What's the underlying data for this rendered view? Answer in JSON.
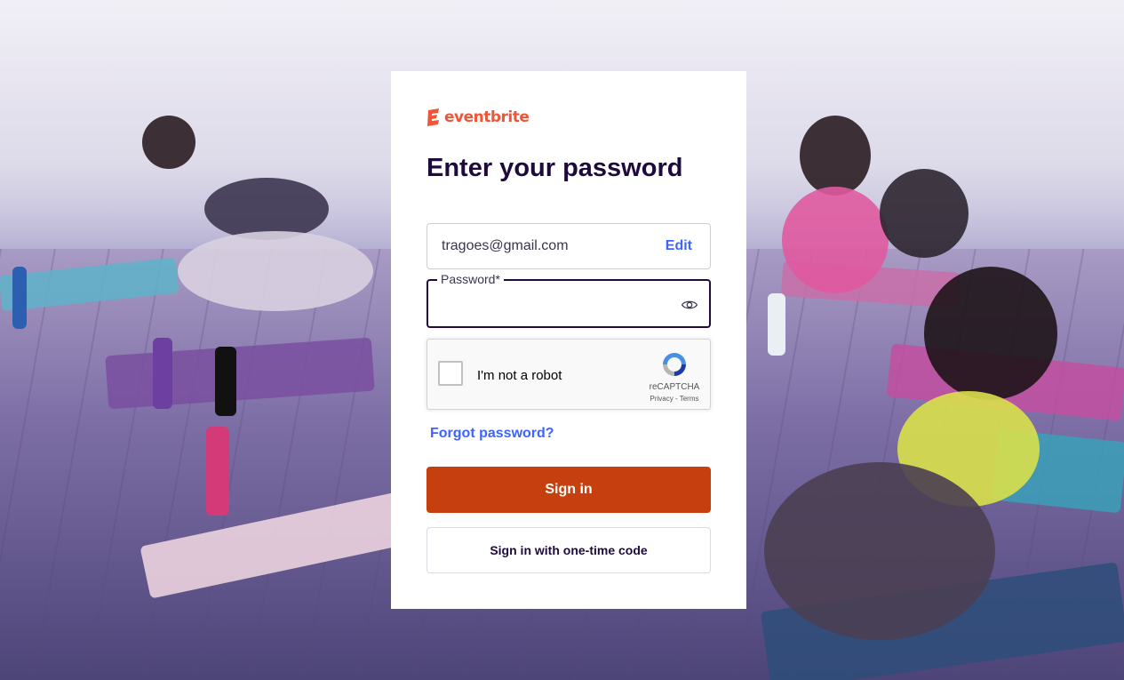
{
  "brand": {
    "name": "eventbrite",
    "color": "#f05537"
  },
  "page": {
    "title": "Enter your password"
  },
  "email": {
    "value": "tragoes@gmail.com",
    "edit_label": "Edit"
  },
  "password": {
    "label": "Password*",
    "value": "",
    "toggle_icon": "eye-icon"
  },
  "captcha": {
    "label": "I'm not a robot",
    "brand": "reCAPTCHA",
    "terms": "Privacy - Terms",
    "checked": false
  },
  "links": {
    "forgot_password": "Forgot password?"
  },
  "buttons": {
    "sign_in": "Sign in",
    "one_time_code": "Sign in with one-time code"
  },
  "colors": {
    "primary_button": "#c5400e",
    "link": "#3d64ff",
    "heading": "#1e0a3c"
  },
  "background": {
    "description_icon": "yoga-class-photo"
  }
}
